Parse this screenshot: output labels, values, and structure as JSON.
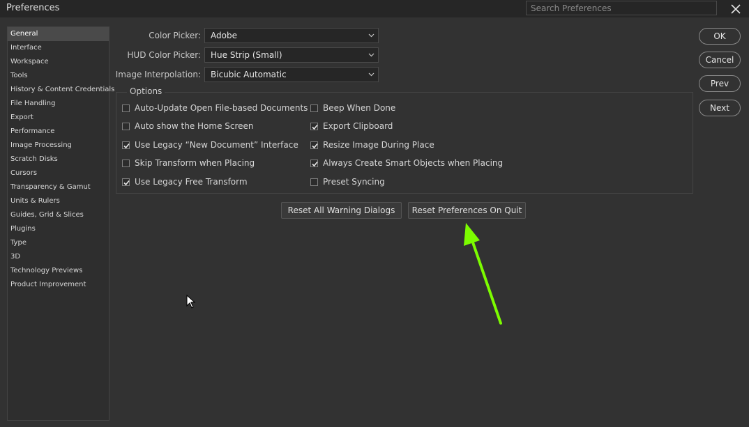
{
  "window": {
    "title": "Preferences"
  },
  "search": {
    "placeholder": "Search Preferences"
  },
  "sidebar": {
    "selected": "General",
    "items": [
      "General",
      "Interface",
      "Workspace",
      "Tools",
      "History & Content Credentials",
      "File Handling",
      "Export",
      "Performance",
      "Image Processing",
      "Scratch Disks",
      "Cursors",
      "Transparency & Gamut",
      "Units & Rulers",
      "Guides, Grid & Slices",
      "Plugins",
      "Type",
      "3D",
      "Technology Previews",
      "Product Improvement"
    ]
  },
  "fields": {
    "color_picker": {
      "label": "Color Picker:",
      "value": "Adobe"
    },
    "hud_color_picker": {
      "label": "HUD Color Picker:",
      "value": "Hue Strip (Small)"
    },
    "image_interpolation": {
      "label": "Image Interpolation:",
      "value": "Bicubic Automatic"
    }
  },
  "options": {
    "legend": "Options",
    "left": [
      {
        "label": "Auto-Update Open File-based Documents",
        "checked": false
      },
      {
        "label": "Auto show the Home Screen",
        "checked": false
      },
      {
        "label": "Use Legacy “New Document” Interface",
        "checked": true
      },
      {
        "label": "Skip Transform when Placing",
        "checked": false
      },
      {
        "label": "Use Legacy Free Transform",
        "checked": true
      }
    ],
    "right": [
      {
        "label": "Beep When Done",
        "checked": false
      },
      {
        "label": "Export Clipboard",
        "checked": true
      },
      {
        "label": "Resize Image During Place",
        "checked": true
      },
      {
        "label": "Always Create Smart Objects when Placing",
        "checked": true
      },
      {
        "label": "Preset Syncing",
        "checked": false
      }
    ]
  },
  "buttons": {
    "reset_warnings": "Reset All Warning Dialogs",
    "reset_prefs": "Reset Preferences On Quit",
    "ok": "OK",
    "cancel": "Cancel",
    "prev": "Prev",
    "next": "Next"
  },
  "colors": {
    "background": "#323232",
    "titlebar": "#262626",
    "annotation_arrow": "#7CFC00"
  }
}
